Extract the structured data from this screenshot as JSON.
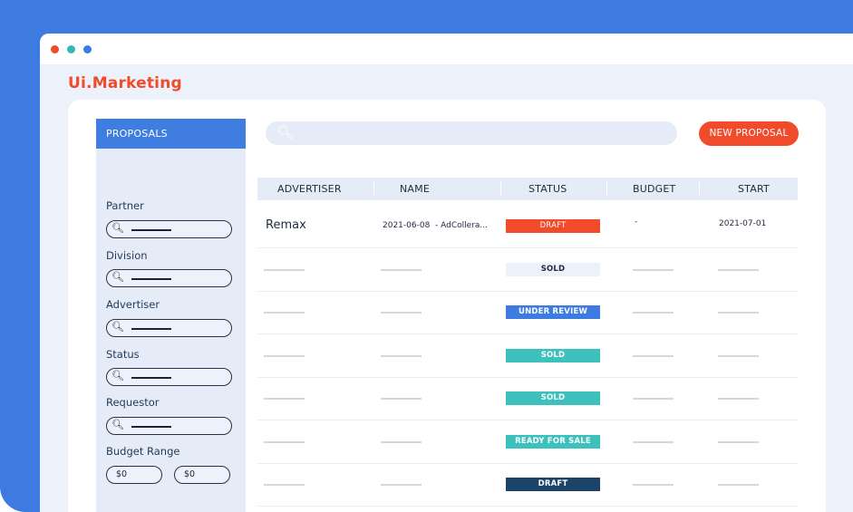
{
  "brand": "Ui.Marketing",
  "sidebar": {
    "header": "PROPOSALS",
    "filters": [
      {
        "label": "Partner"
      },
      {
        "label": "Division"
      },
      {
        "label": "Advertiser"
      },
      {
        "label": "Status"
      },
      {
        "label": "Requestor"
      }
    ],
    "budget_range": {
      "label": "Budget Range",
      "min": "$0",
      "max": "$0"
    }
  },
  "toolbar": {
    "new_proposal_label": "NEW PROPOSAL"
  },
  "table": {
    "columns": [
      "ADVERTISER",
      "NAME",
      "STATUS",
      "BUDGET",
      "START"
    ],
    "first_row": {
      "advertiser": "Remax",
      "name": "2021-06-08  - AdCollera...",
      "status": "DRAFT",
      "budget": "-",
      "start": "2021-07-01"
    },
    "statuses": [
      "SOLD",
      "UNDER REVIEW",
      "SOLD",
      "SOLD",
      "READY FOR SALE",
      "DRAFT"
    ]
  },
  "status_colors": {
    "draft_first": "#f04b2a",
    "sold_plain": "#edf1f9",
    "under_review": "#3d7be0",
    "sold": "#3cc1bd",
    "ready_for_sale": "#3cc1bd",
    "draft": "#1b4468"
  },
  "colors": {
    "accent": "#f04b2a",
    "primary": "#3d7be0"
  }
}
